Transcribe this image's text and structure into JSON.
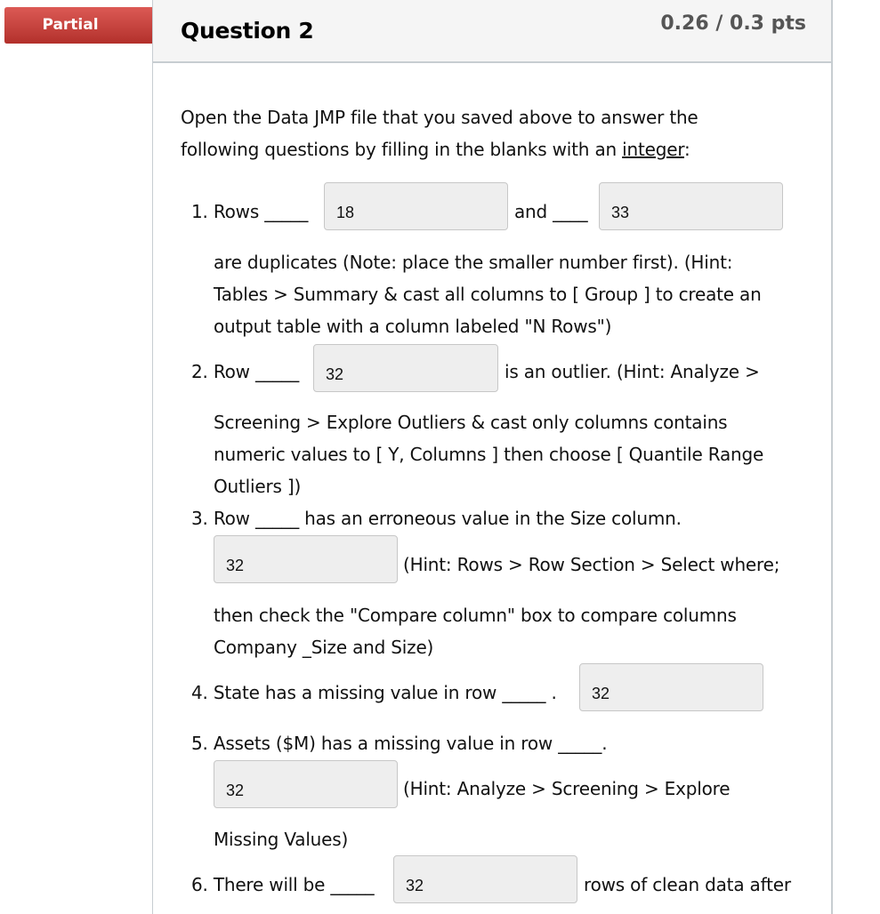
{
  "badge": {
    "label": "Partial",
    "color": "#c9302c"
  },
  "question": {
    "title": "Question 2",
    "points": "0.26 / 0.3 pts"
  },
  "intro": {
    "line1": "Open the Data JMP file that you saved above to answer the",
    "line2_prefix": "following questions by filling in the blanks with an ",
    "line2_underlined": "integer",
    "line2_suffix": ":"
  },
  "items": {
    "q1": {
      "prefix": "1. Rows _____",
      "mid": "and ____",
      "answer1": "18",
      "answer2": "33",
      "lines": [
        "are duplicates (Note: place the smaller number first).  (Hint:",
        "Tables > Summary & cast all columns to [ Group ] to create an",
        "output table with a column labeled \"N Rows\")"
      ]
    },
    "q2": {
      "prefix": "2. Row _____",
      "answer": "32",
      "suffix": "is an outlier.  (Hint: Analyze >",
      "lines": [
        "Screening > Explore Outliers & cast only columns contains",
        "numeric values to [ Y, Columns ] then choose [ Quantile Range",
        "Outliers ])"
      ]
    },
    "q3": {
      "prefix": "3. Row  _____ has an erroneous value in the Size column.",
      "answer": "32",
      "suffix": "(Hint: Rows > Row Section > Select where;",
      "lines": [
        "then check the \"Compare column\" box to compare columns",
        "Company _Size and Size)"
      ]
    },
    "q4": {
      "prefix": "4. State has a missing value in row _____ .",
      "answer": "32"
    },
    "q5": {
      "prefix": "5. Assets ($M) has a missing value in row _____.",
      "answer": "32",
      "suffix": "(Hint: Analyze > Screening > Explore",
      "lines": [
        "Missing Values)"
      ]
    },
    "q6": {
      "prefix": "6. There will be _____",
      "answer": "32",
      "suffix": "rows of clean data after"
    }
  }
}
